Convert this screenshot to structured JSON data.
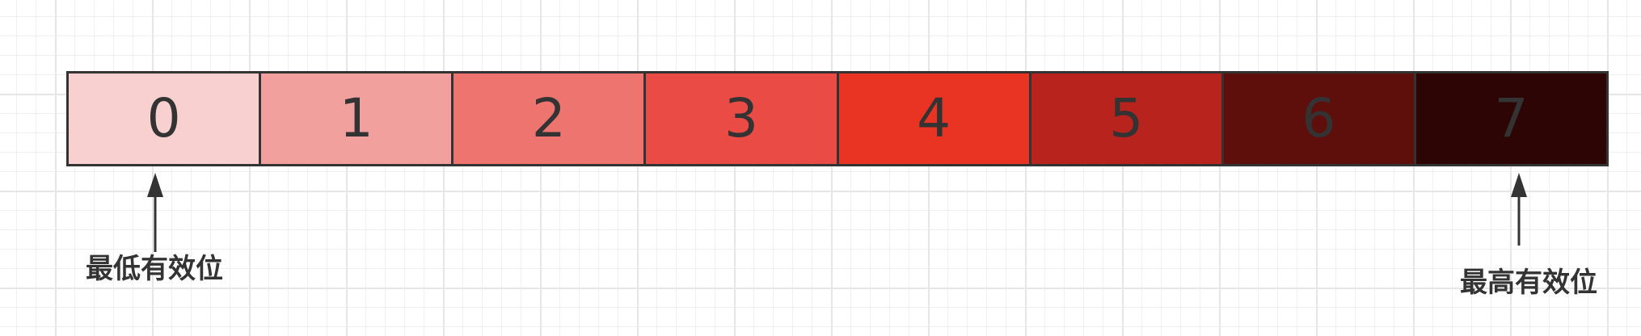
{
  "bits": [
    {
      "label": "0",
      "fill": "#f8d0cf"
    },
    {
      "label": "1",
      "fill": "#f2a09d"
    },
    {
      "label": "2",
      "fill": "#ed746f"
    },
    {
      "label": "3",
      "fill": "#ea4b45"
    },
    {
      "label": "4",
      "fill": "#e93323"
    },
    {
      "label": "5",
      "fill": "#b9231d"
    },
    {
      "label": "6",
      "fill": "#5e0f0b"
    },
    {
      "label": "7",
      "fill": "#2d0504"
    }
  ],
  "annotations": {
    "lsb": "最低有效位",
    "msb": "最高有效位"
  },
  "colors": {
    "stroke": "#333333",
    "text": "#333333"
  }
}
